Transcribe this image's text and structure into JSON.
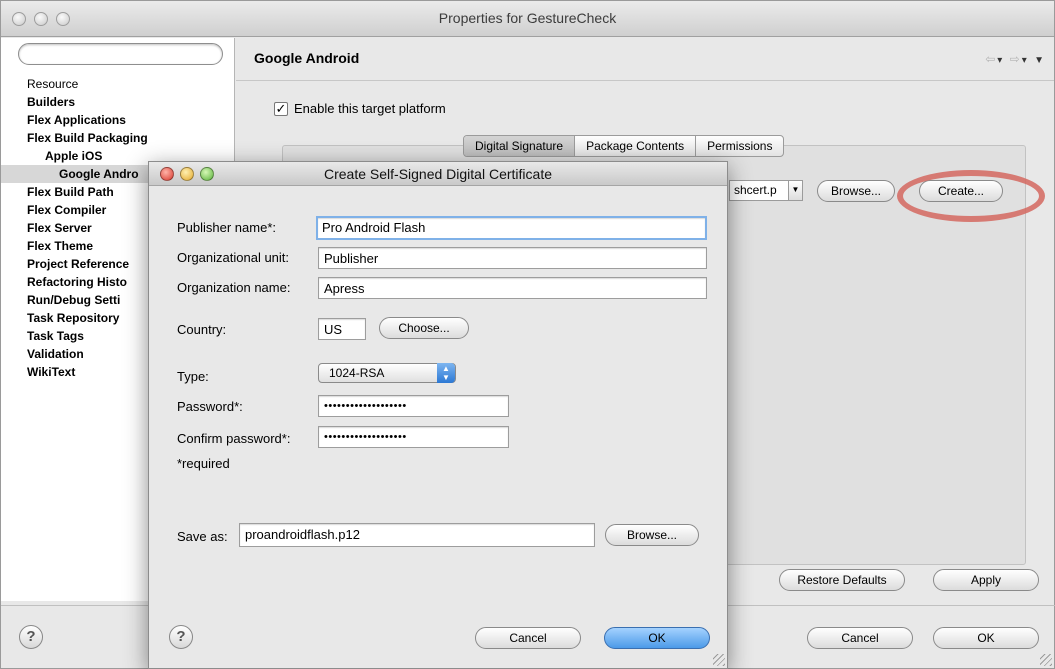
{
  "window": {
    "title": "Properties for GestureCheck"
  },
  "sidebar": {
    "filter_placeholder": "",
    "items": [
      {
        "label": "Resource",
        "expander": "▶"
      },
      {
        "label": "Builders"
      },
      {
        "label": "Flex Applications"
      },
      {
        "label": "Flex Build Packaging",
        "expander": "▼"
      },
      {
        "label": "Apple iOS"
      },
      {
        "label": "Google Andro"
      },
      {
        "label": "Flex Build Path"
      },
      {
        "label": "Flex Compiler"
      },
      {
        "label": "Flex Server"
      },
      {
        "label": "Flex Theme"
      },
      {
        "label": "Project Reference"
      },
      {
        "label": "Refactoring Histo"
      },
      {
        "label": "Run/Debug Setti"
      },
      {
        "label": "Task Repository",
        "expander": "▶"
      },
      {
        "label": "Task Tags"
      },
      {
        "label": "Validation"
      },
      {
        "label": "WikiText"
      }
    ]
  },
  "main": {
    "title": "Google Android",
    "nav": {
      "back": "⇦",
      "forward": "⇨",
      "menu": "▼"
    },
    "enable_label": "Enable this target platform",
    "enable_checked": "✓",
    "tabs": [
      "Digital Signature",
      "Package Contents",
      "Permissions"
    ],
    "certificate_value": "shcert.p",
    "browse_label": "Browse...",
    "create_label": "Create...",
    "restore_label": "Restore Defaults",
    "apply_label": "Apply",
    "cancel_label": "Cancel",
    "ok_label": "OK",
    "help_glyph": "?"
  },
  "dialog": {
    "title": "Create Self-Signed Digital Certificate",
    "publisher_label": "Publisher name*:",
    "publisher_value": "Pro Android Flash",
    "org_unit_label": "Organizational unit:",
    "org_unit_value": "Publisher",
    "org_name_label": "Organization name:",
    "org_name_value": "Apress",
    "country_label": "Country:",
    "country_value": "US",
    "choose_label": "Choose...",
    "type_label": "Type:",
    "type_value": "1024-RSA",
    "password_label": "Password*:",
    "password_value": "•••••••••••••••••••",
    "confirm_label": "Confirm password*:",
    "confirm_value": "•••••••••••••••••••",
    "required_note": "*required",
    "save_as_label": "Save as:",
    "save_as_value": "proandroidflash.p12",
    "browse_label": "Browse...",
    "cancel_label": "Cancel",
    "ok_label": "OK",
    "help_glyph": "?"
  }
}
